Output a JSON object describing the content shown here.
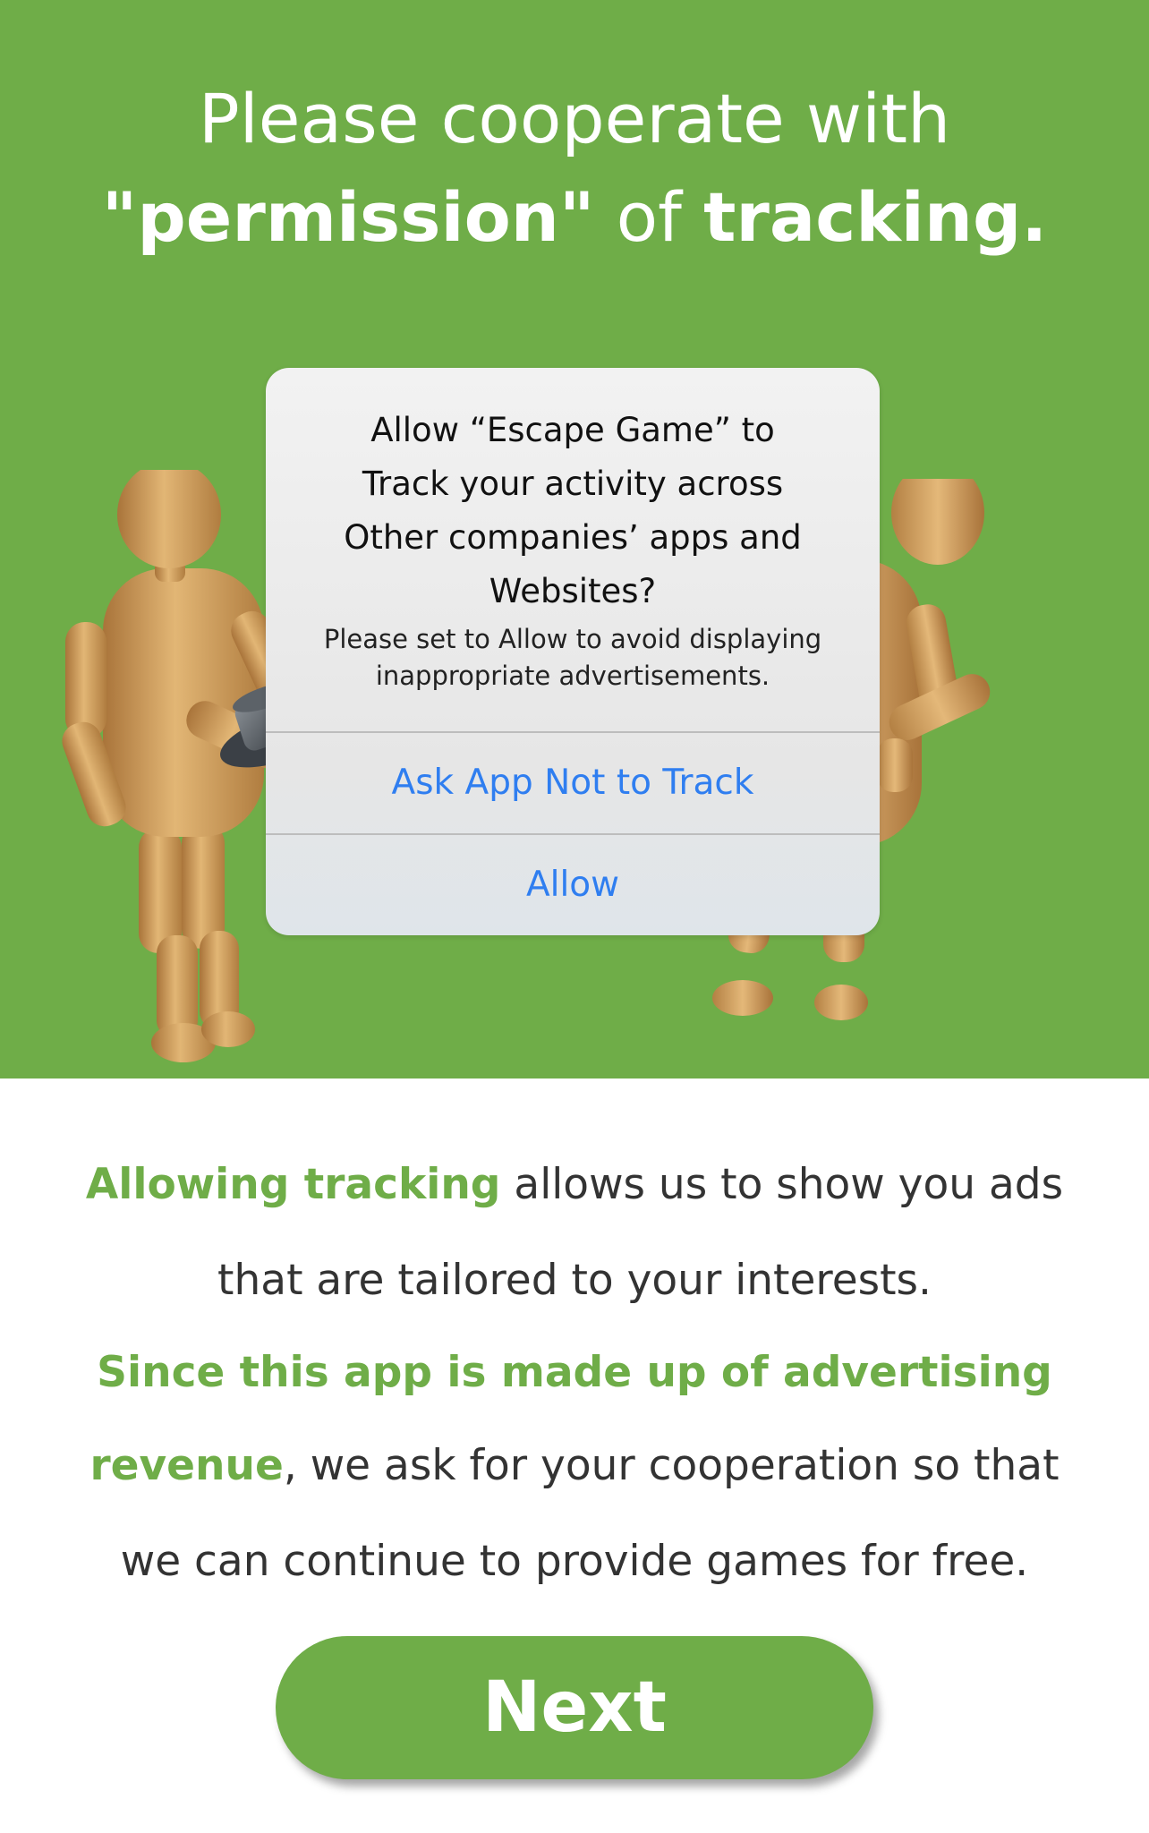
{
  "hero": {
    "title_line1": "Please cooperate with",
    "title_q_open": "\"",
    "title_permission": "permission",
    "title_q_close": "\"",
    "title_of": " of ",
    "title_tracking": "tracking."
  },
  "dialog": {
    "title_line1": "Allow “Escape Game” to",
    "title_line2": "Track your activity across",
    "title_line3": "Other companies’ apps and",
    "title_line4": "Websites?",
    "message_line1": "Please set to Allow to avoid displaying",
    "message_line2": "inappropriate advertisements.",
    "ask_not_track_label": "Ask App Not to Track",
    "allow_label": "Allow"
  },
  "body": {
    "hl1": "Allowing tracking",
    "text1": " allows us to show you ads",
    "text2": "that are tailored to your interests.",
    "hl2": "Since this app is made up of advertising",
    "hl3": "revenue",
    "text3": ", we ask for your cooperation so that",
    "text4": "we can continue to provide games for free."
  },
  "next_label": "Next",
  "colors": {
    "brand_green": "#6fad48",
    "ios_link_blue": "#2f7ef0",
    "figure_wood": "#d9ab65"
  },
  "icons": {
    "left_figure": "wooden-mannequin-with-top-hat",
    "right_figure": "wooden-mannequin"
  }
}
